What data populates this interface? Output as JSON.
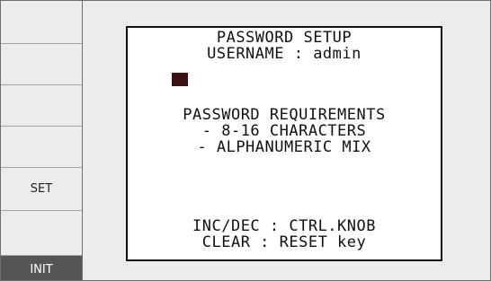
{
  "softkeys": [
    "",
    "",
    "",
    "",
    "SET",
    "",
    "INIT"
  ],
  "panel": {
    "title": "PASSWORD SETUP",
    "username_line": "USERNAME : admin",
    "requirements_heading": "PASSWORD REQUIREMENTS",
    "requirement_1": "- 8-16 CHARACTERS",
    "requirement_2": "- ALPHANUMERIC MIX",
    "hint_1": "INC/DEC : CTRL.KNOB",
    "hint_2": "CLEAR : RESET key"
  }
}
